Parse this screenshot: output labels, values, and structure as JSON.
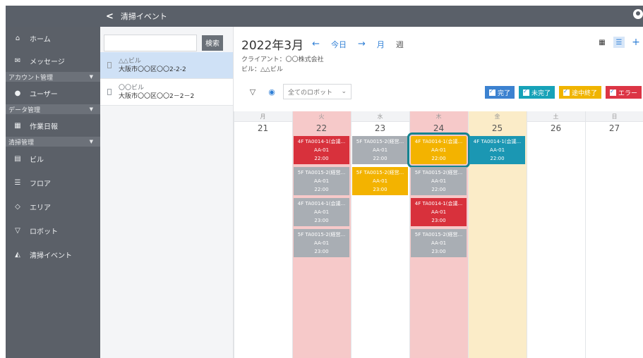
{
  "topbar": {
    "back_title": "清掃イベント"
  },
  "sidebar": {
    "items": [
      {
        "label": "ホーム",
        "icon": "home-icon",
        "glyph": "⌂"
      },
      {
        "label": "メッセージ",
        "icon": "message-icon",
        "glyph": "✉"
      }
    ],
    "section_account": "アカウント管理",
    "user_label": "ユーザー",
    "section_data": "データ管理",
    "daily_report_label": "作業日報",
    "section_cleaning": "清掃管理",
    "cleaning_items": [
      {
        "label": "ビル",
        "icon": "building-icon",
        "glyph": "▤"
      },
      {
        "label": "フロア",
        "icon": "floor-icon",
        "glyph": "☰"
      },
      {
        "label": "エリア",
        "icon": "area-icon",
        "glyph": "◇"
      },
      {
        "label": "ロボット",
        "icon": "robot-icon",
        "glyph": "▽"
      },
      {
        "label": "清掃イベント",
        "icon": "cleaning-event-icon",
        "glyph": "◭"
      }
    ]
  },
  "buildings": {
    "search_placeholder": "",
    "search_button": "検索",
    "list": [
      {
        "name": "△△ビル",
        "address": "大阪市〇〇区〇〇2-2-2",
        "selected": true
      },
      {
        "name": "〇〇ビル",
        "address": "大阪市〇〇区〇〇2－2－2",
        "selected": false
      }
    ]
  },
  "calendar": {
    "title": "2022年3月",
    "prev": "←",
    "today": "今日",
    "next": "→",
    "month": "月",
    "week": "週",
    "client": "クライアント：〇〇株式会社",
    "building": "ビル：△△ビル",
    "robot_select": "全てのロボット",
    "status_filters": [
      {
        "label": "完了",
        "color": "#3c82d0"
      },
      {
        "label": "未完了",
        "color": "#17a2b8"
      },
      {
        "label": "途中終了",
        "color": "#f0b400"
      },
      {
        "label": "エラー",
        "color": "#dc3545"
      }
    ],
    "days": [
      {
        "dow": "月",
        "num": "21"
      },
      {
        "dow": "火",
        "num": "22"
      },
      {
        "dow": "水",
        "num": "23"
      },
      {
        "dow": "木",
        "num": "24"
      },
      {
        "dow": "金",
        "num": "25"
      },
      {
        "dow": "土",
        "num": "26"
      },
      {
        "dow": "日",
        "num": "27"
      }
    ],
    "events": {
      "d22": [
        {
          "t": "4F TA0014-1(会議...",
          "r": "AA-01",
          "time": "22:00",
          "color": "red"
        },
        {
          "t": "5F TA0015-2(経営...",
          "r": "AA-01",
          "time": "22:00",
          "color": "gray"
        },
        {
          "t": "4F TA0014-1(会議...",
          "r": "AA-01",
          "time": "23:00",
          "color": "gray"
        },
        {
          "t": "5F TA0015-2(経営...",
          "r": "AA-01",
          "time": "23:00",
          "color": "gray"
        }
      ],
      "d23": [
        {
          "t": "5F TA0015-2(経営...",
          "r": "AA-01",
          "time": "22:00",
          "color": "gray"
        },
        {
          "t": "5F TA0015-2(経営...",
          "r": "AA-01",
          "time": "23:00",
          "color": "yellow"
        }
      ],
      "d24": [
        {
          "t": "4F TA0014-1(会議...",
          "r": "AA-01",
          "time": "22:00",
          "color": "yellow"
        },
        {
          "t": "5F TA0015-2(経営...",
          "r": "AA-01",
          "time": "22:00",
          "color": "gray"
        },
        {
          "t": "4F TA0014-1(会議...",
          "r": "AA-01",
          "time": "23:00",
          "color": "red"
        },
        {
          "t": "5F TA0015-2(経営...",
          "r": "AA-01",
          "time": "23:00",
          "color": "gray"
        }
      ],
      "d25": [
        {
          "t": "4F TA0014-1(会議...",
          "r": "AA-01",
          "time": "22:00",
          "color": "teal"
        }
      ]
    }
  }
}
